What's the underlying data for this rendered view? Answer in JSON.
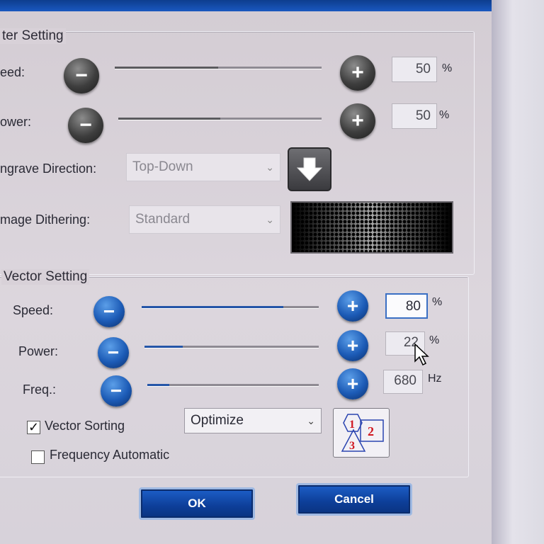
{
  "raster": {
    "title": "ter Setting",
    "speed": {
      "label": "eed:",
      "value": "50",
      "unit": "%",
      "level": 0.5
    },
    "power": {
      "label": "ower:",
      "value": "50",
      "unit": "%",
      "level": 0.5
    },
    "engrave_direction": {
      "label": "ngrave Direction:",
      "selected": "Top-Down"
    },
    "dithering": {
      "label": "mage Dithering:",
      "selected": "Standard"
    }
  },
  "vector": {
    "title": "Vector Setting",
    "speed": {
      "label": "Speed:",
      "value": "80",
      "unit": "%",
      "level": 0.8
    },
    "power": {
      "label": "Power:",
      "value": "22",
      "unit": "%",
      "level": 0.22
    },
    "freq": {
      "label": "Freq.:",
      "value": "680",
      "unit": "Hz",
      "level": 0.13
    },
    "vector_sorting": {
      "label": "Vector Sorting",
      "checked": true,
      "selected": "Optimize"
    },
    "frequency_automatic": {
      "label": "Frequency Automatic",
      "checked": false
    },
    "sort_order_digits": [
      "1",
      "2",
      "3"
    ]
  },
  "buttons": {
    "ok": "OK",
    "cancel": "Cancel"
  },
  "icons": {
    "minus": "minus-icon",
    "plus": "plus-icon",
    "down_arrow": "down-arrow-icon",
    "dropdown": "chevron-down-icon",
    "sort": "vector-sort-order-icon",
    "cursor": "mouse-cursor-icon"
  },
  "colors": {
    "accent_blue": "#1c5bb6",
    "button_blue": "#0d3e98",
    "sort_digit_red": "#d01820"
  }
}
